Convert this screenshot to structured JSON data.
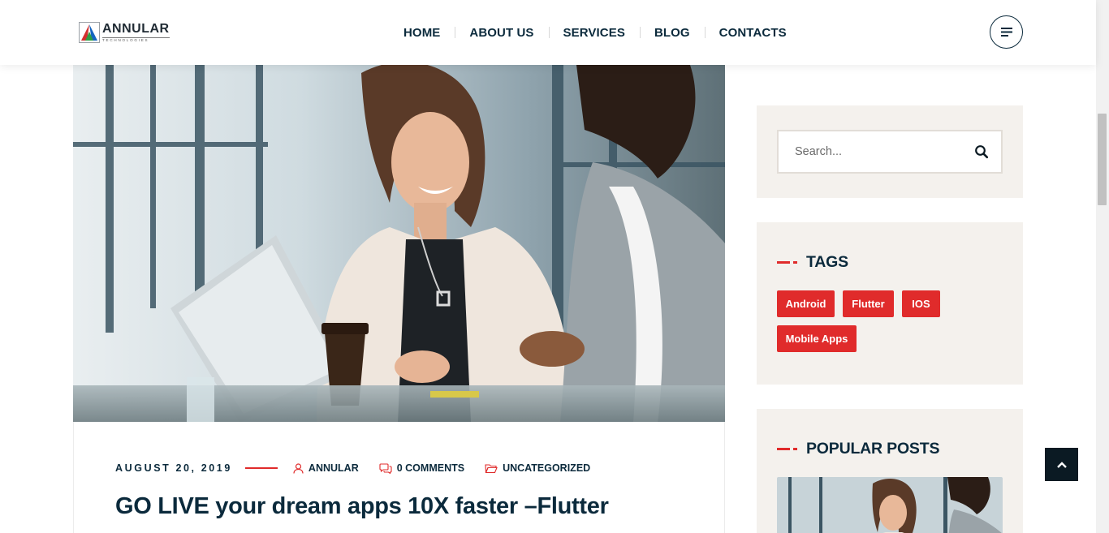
{
  "brand": {
    "name": "ANNULAR",
    "tagline": "TECHNOLOGIES",
    "colors": {
      "accent": "#e02b2b",
      "navy": "#0b2a3c",
      "widget_bg": "#f4f1ed"
    }
  },
  "nav": {
    "items": [
      {
        "label": "HOME"
      },
      {
        "label": "ABOUT US"
      },
      {
        "label": "SERVICES"
      },
      {
        "label": "BLOG"
      },
      {
        "label": "CONTACTS"
      }
    ],
    "menu_icon": "hamburger-icon"
  },
  "post": {
    "image_alt_icon": "office-photo",
    "date": "AUGUST 20, 2019",
    "author": "ANNULAR",
    "comments": "0 COMMENTS",
    "category": "UNCATEGORIZED",
    "title": "GO LIVE your dream apps 10X faster –Flutter"
  },
  "sidebar": {
    "search": {
      "placeholder": "Search...",
      "value": "",
      "icon": "search-icon"
    },
    "tags": {
      "title": "TAGS",
      "items": [
        {
          "label": "Android"
        },
        {
          "label": "Flutter"
        },
        {
          "label": "IOS"
        },
        {
          "label": "Mobile Apps"
        }
      ]
    },
    "popular": {
      "title": "POPULAR POSTS"
    }
  },
  "back_to_top": {
    "icon": "chevron-up-icon"
  }
}
